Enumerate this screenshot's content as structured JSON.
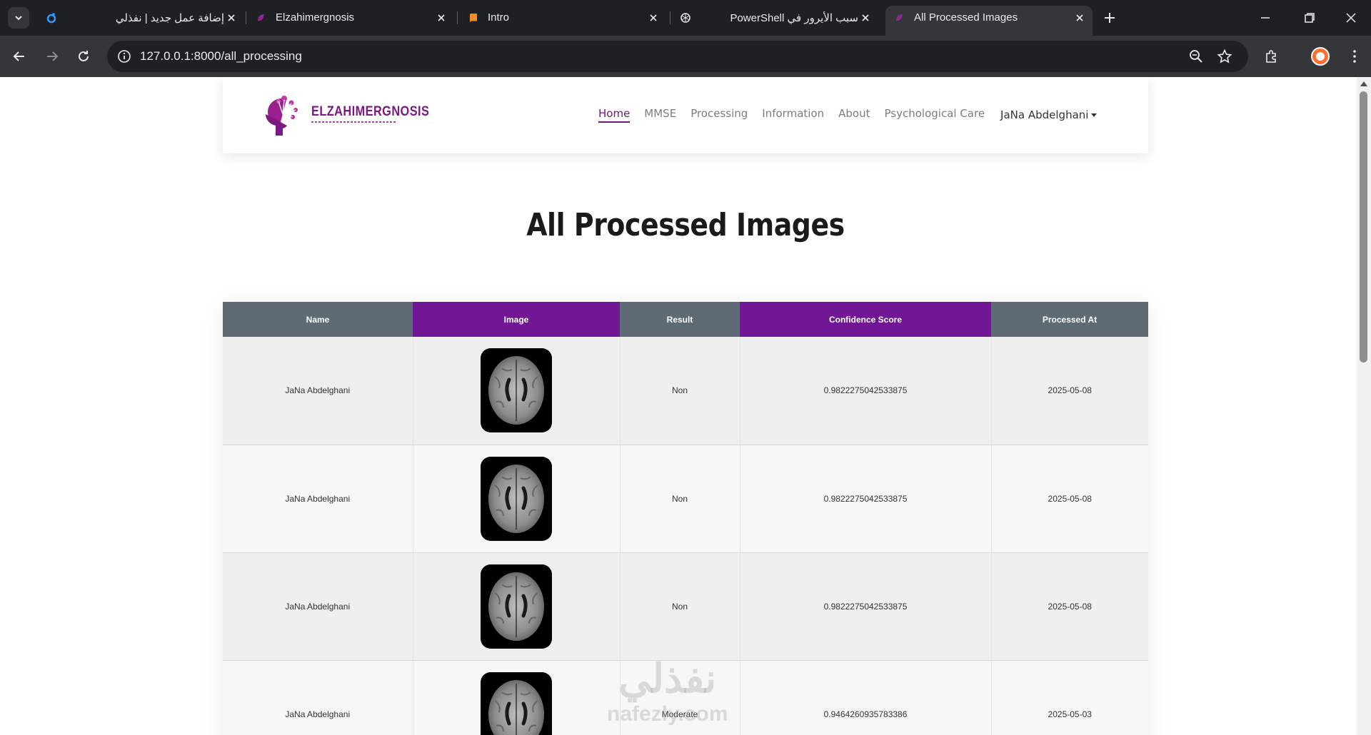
{
  "browser": {
    "tabs": [
      {
        "title": "إضافة عمل جديد | نفذلي",
        "active": false,
        "rtl": true
      },
      {
        "title": "Elzahimergnosis",
        "active": false,
        "rtl": false
      },
      {
        "title": "Intro",
        "active": false,
        "rtl": false
      },
      {
        "title": "سبب الأيرور في PowerShell",
        "active": false,
        "rtl": true
      },
      {
        "title": "All Processed Images",
        "active": true,
        "rtl": false
      }
    ],
    "url": "127.0.0.1:8000/all_processing"
  },
  "navbar": {
    "logo_text": "ELZAHIMERGNOSIS",
    "links": [
      "Home",
      "MMSE",
      "Processing",
      "Information",
      "About",
      "Psychological Care"
    ],
    "active_link": "Home",
    "user_name": "JaNa Abdelghani"
  },
  "page": {
    "title": "All Processed Images"
  },
  "table": {
    "headers": [
      "Name",
      "Image",
      "Result",
      "Confidence Score",
      "Processed At"
    ],
    "rows": [
      {
        "name": "JaNa Abdelghani",
        "result": "Non",
        "confidence": "0.9822275042533875",
        "processed_at": "2025-05-08"
      },
      {
        "name": "JaNa Abdelghani",
        "result": "Non",
        "confidence": "0.9822275042533875",
        "processed_at": "2025-05-08"
      },
      {
        "name": "JaNa Abdelghani",
        "result": "Non",
        "confidence": "0.9822275042533875",
        "processed_at": "2025-05-08"
      },
      {
        "name": "JaNa Abdelghani",
        "result": "Moderate",
        "confidence": "0.9464260935783386",
        "processed_at": "2025-05-03"
      }
    ]
  },
  "watermark": {
    "arabic": "نفذلي",
    "latin": "nafezly.com"
  },
  "colors": {
    "header_gray": "#5f6b74",
    "header_purple": "#711796",
    "brand_purple": "#7a1a82",
    "chrome_dark": "#1f2023",
    "chrome_mid": "#35363a"
  }
}
